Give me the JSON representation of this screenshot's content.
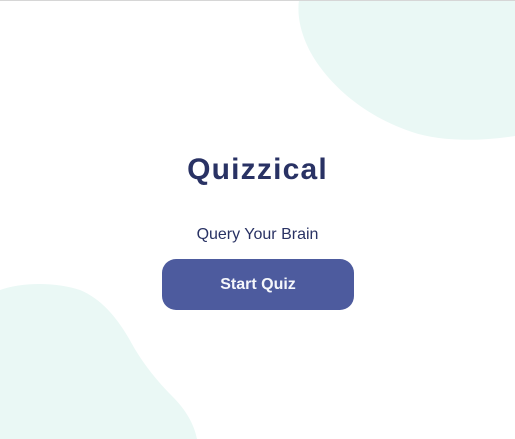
{
  "app": {
    "title": "Quizzical",
    "tagline": "Query Your Brain"
  },
  "actions": {
    "start_label": "Start Quiz"
  },
  "theme": {
    "title_color": "#293264",
    "button_color": "#4D5B9E",
    "button_text_color": "#F5F7FB",
    "blob_color": "#EAF8F5"
  }
}
